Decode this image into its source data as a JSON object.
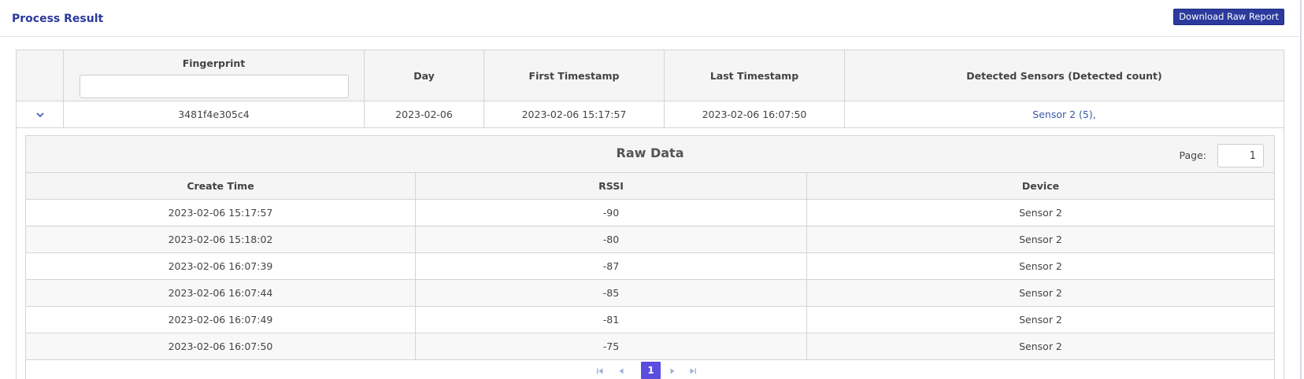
{
  "header": {
    "title": "Process Result",
    "download_label": "Download Raw Report"
  },
  "result_table": {
    "headers": {
      "fingerprint": "Fingerprint",
      "day": "Day",
      "first_timestamp": "First Timestamp",
      "last_timestamp": "Last Timestamp",
      "detected_sensors": "Detected Sensors (Detected count)"
    },
    "fingerprint_filter_value": "",
    "row": {
      "fingerprint": "3481f4e305c4",
      "day": "2023-02-06",
      "first_timestamp": "2023-02-06 15:17:57",
      "last_timestamp": "2023-02-06 16:07:50",
      "detected_sensors": "Sensor 2 (5),"
    }
  },
  "raw_data": {
    "title": "Raw Data",
    "page_label": "Page:",
    "page_value": "1",
    "headers": {
      "create_time": "Create Time",
      "rssi": "RSSI",
      "device": "Device"
    },
    "rows": [
      {
        "create_time": "2023-02-06 15:17:57",
        "rssi": "-90",
        "device": "Sensor 2"
      },
      {
        "create_time": "2023-02-06 15:18:02",
        "rssi": "-80",
        "device": "Sensor 2"
      },
      {
        "create_time": "2023-02-06 16:07:39",
        "rssi": "-87",
        "device": "Sensor 2"
      },
      {
        "create_time": "2023-02-06 16:07:44",
        "rssi": "-85",
        "device": "Sensor 2"
      },
      {
        "create_time": "2023-02-06 16:07:49",
        "rssi": "-81",
        "device": "Sensor 2"
      },
      {
        "create_time": "2023-02-06 16:07:50",
        "rssi": "-75",
        "device": "Sensor 2"
      }
    ],
    "pager": {
      "current_page": "1",
      "icons": [
        "first-page-icon",
        "prev-page-icon",
        "next-page-icon",
        "last-page-icon"
      ]
    }
  },
  "colors": {
    "brand": "#2b3a9c",
    "link": "#3c5aa8",
    "pager_active": "#5a4ee0"
  }
}
